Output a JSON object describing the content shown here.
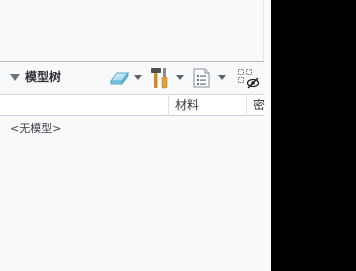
{
  "model_tree": {
    "title": "模型树",
    "empty_message": "<无模型>",
    "columns": [
      {
        "label": "材料"
      },
      {
        "label": "密"
      }
    ]
  },
  "toolbar": {
    "items": [
      {
        "icon": "eraser-icon"
      },
      {
        "icon": "tools-hammer-screwdriver-icon"
      },
      {
        "icon": "list-settings-icon"
      },
      {
        "icon": "show-hide-icon"
      }
    ]
  },
  "colors": {
    "panel_background": "#f7f9fb",
    "column_header_background": "#ffffff",
    "outer_background": "#000000",
    "text": "#2e3033"
  }
}
